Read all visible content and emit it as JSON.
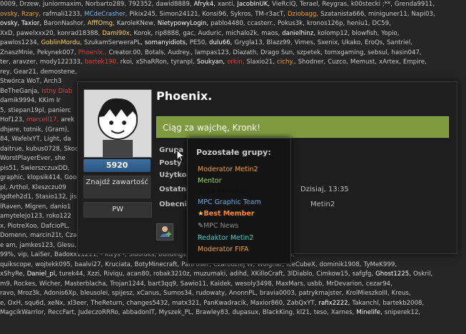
{
  "background_rows": [
    [
      {
        "t": "0009, Drzew,"
      },
      {
        "t": "juniormaxim,"
      },
      {
        "t": "Norbarto289,"
      },
      {
        "t": "792352,"
      },
      {
        "t": "dawid8889,"
      },
      {
        "t": "Afryk4,",
        "c": "c-white"
      },
      {
        "t": "xanti,"
      },
      {
        "t": "JacobInUK,",
        "c": "c-white"
      },
      {
        "t": "VieRciQ,"
      },
      {
        "t": "Terael,"
      },
      {
        "t": "Reygras,"
      },
      {
        "t": "k00stecki ;**,"
      },
      {
        "t": "Grenda9911,"
      }
    ],
    [
      {
        "t": "ovsky, Rzary,",
        "c": "c-orange"
      },
      {
        "t": "rafmali1233,"
      },
      {
        "t": "MCdeCrasher,",
        "c": "c-blue"
      },
      {
        "t": "Pikix245,"
      },
      {
        "t": "Simon24121,"
      },
      {
        "t": "Konsi96,"
      },
      {
        "t": "Sykros,"
      },
      {
        "t": "TM-r3acT,"
      },
      {
        "t": "Dziobagg,",
        "c": "c-orange"
      },
      {
        "t": "Szatanista666,"
      },
      {
        "t": "miniguner11,"
      },
      {
        "t": "Napi03,"
      }
    ],
    [
      {
        "t": "ovsky, Taxior,",
        "c": "c-white"
      },
      {
        "t": "BaronNashor,"
      },
      {
        "t": "AfffOmg,",
        "c": "c-yellow"
      },
      {
        "t": "KaroleKNew,"
      },
      {
        "t": "NietypowyLogin,",
        "c": "c-white"
      },
      {
        "t": "pablo4480,"
      },
      {
        "t": "ccasterr.,"
      },
      {
        "t": "Pokus3k,"
      },
      {
        "t": "kronos126p,"
      },
      {
        "t": "heniu1,"
      },
      {
        "t": "DC59,"
      }
    ],
    [
      {
        "t": "XxD, pawelxxx20,"
      },
      {
        "t": "konrad18388,"
      },
      {
        "t": "Dami90x,",
        "c": "c-yellow"
      },
      {
        "t": "Korok,"
      },
      {
        "t": "rip8888,"
      },
      {
        "t": "gac,"
      },
      {
        "t": "Auduric,"
      },
      {
        "t": "michalo2k,"
      },
      {
        "t": "maos,"
      },
      {
        "t": "danielhinz,",
        "c": "c-white"
      },
      {
        "t": "kolomp12,"
      },
      {
        "t": "blowfish,"
      },
      {
        "t": "Yopio,"
      }
    ],
    [
      {
        "t": "pawlos1234,"
      },
      {
        "t": "GoblinMordu,",
        "c": "c-yellow"
      },
      {
        "t": "SzukamSerweraPL,"
      },
      {
        "t": "somanyidiots,",
        "c": "c-white"
      },
      {
        "t": "PE50,"
      },
      {
        "t": "dulu66,",
        "c": "c-white"
      },
      {
        "t": "Gryglа13,"
      },
      {
        "t": "Blazz99,"
      },
      {
        "t": "Vimes,"
      },
      {
        "t": "Sxenix,"
      },
      {
        "t": "Ukako,"
      },
      {
        "t": "EroQs,"
      },
      {
        "t": "Santriel,"
      }
    ],
    [
      {
        "t": "ZnaszMnie,"
      },
      {
        "t": "Pekynek007,"
      },
      {
        "t": "Phoenix.,",
        "c": "c-red"
      },
      {
        "t": "Creator.00,"
      },
      {
        "t": "Botals,"
      },
      {
        "t": "Audrey.,"
      },
      {
        "t": "lampas123,"
      },
      {
        "t": "Diazath,"
      },
      {
        "t": "Drago Sun,"
      },
      {
        "t": "szpetek,"
      },
      {
        "t": "tomxgaming,"
      },
      {
        "t": "sebsul,"
      },
      {
        "t": "hasin047,"
      }
    ],
    [
      {
        "t": "ter, aravzer,"
      },
      {
        "t": "mody122333,"
      },
      {
        "t": "bartek190,",
        "c": "c-red"
      },
      {
        "t": "rkoi,"
      },
      {
        "t": "xShaRRon,"
      },
      {
        "t": "tyranpl,"
      },
      {
        "t": "Soukyan,",
        "c": "c-white"
      },
      {
        "t": "orkin,",
        "c": "c-red"
      },
      {
        "t": "Slaxio21,"
      },
      {
        "t": "cichy.,",
        "c": "c-orange"
      },
      {
        "t": "Shodner,"
      },
      {
        "t": "Cuzco,"
      },
      {
        "t": "Memust,"
      },
      {
        "t": "xArtex,"
      },
      {
        "t": "Empire,"
      }
    ],
    [
      {
        "t": "rey, Gear21,"
      },
      {
        "t": "demostene,"
      }
    ],
    [
      {
        "t": "Stwórca WoT,"
      },
      {
        "t": "Arch3"
      }
    ],
    [
      {
        "t": "BeTheGanja,"
      },
      {
        "t": "Istny Diab",
        "c": "c-red"
      }
    ],
    [
      {
        "t": "damik9994,"
      },
      {
        "t": "KKim Ir"
      }
    ],
    [
      {
        "t": "5,"
      },
      {
        "t": "stiepan19pl,"
      },
      {
        "t": "panierc"
      }
    ],
    [
      {
        "t": "Hof123,"
      },
      {
        "t": "marcell17,",
        "c": "c-red"
      },
      {
        "t": "arek"
      }
    ],
    [
      {
        "t": "dhjere,"
      },
      {
        "t": "totnik,"
      },
      {
        "t": "(Gram),"
      }
    ],
    [
      {
        "t": "84, WafelxYT,"
      },
      {
        "t": "Light,"
      },
      {
        "t": "da"
      }
    ],
    [
      {
        "t": "daitrue,"
      },
      {
        "t": "kubus0728,"
      },
      {
        "t": "Skoc"
      }
    ],
    [
      {
        "t": "WorstPlayerEver,"
      },
      {
        "t": "she"
      }
    ],
    [
      {
        "t": "pis51,"
      },
      {
        "t": "SwierszczuxDD,"
      }
    ],
    [
      {
        "t": "graphic,"
      },
      {
        "t": "klopsik414,"
      },
      {
        "t": "Good"
      }
    ],
    [
      {
        "t": "pl, Arthol,"
      },
      {
        "t": "Kleszczu09"
      }
    ],
    [
      {
        "t": "Igdteh2d1,"
      },
      {
        "t": "Stasio132,"
      },
      {
        "t": "jiss"
      }
    ],
    [
      {
        "t": "lRaven,"
      },
      {
        "t": "Migren,"
      },
      {
        "t": "danio1"
      }
    ],
    [
      {
        "t": "amytelejo123,"
      },
      {
        "t": "roko122"
      }
    ],
    [
      {
        "t": "x, PiotreXoo,"
      },
      {
        "t": "DafcioPL,"
      }
    ],
    [
      {
        "t": "Domenn,"
      },
      {
        "t": "marcin21t,"
      },
      {
        "t": "Cza"
      }
    ],
    [
      {
        "t": "e am,"
      },
      {
        "t": "jamkes123,"
      },
      {
        "t": "Glesu,"
      },
      {
        "t": "TheKuduro,"
      },
      {
        "t": "Tomodachi,"
      },
      {
        "t": "raxooo"
      },
      {
        "t": "HaKERxD,"
      },
      {
        "t": "Groxik077,"
      },
      {
        "t": "AnayerTeam,"
      },
      {
        "t": "AdamekXx,"
      }
    ],
    [
      {
        "t": "99%,"
      },
      {
        "t": "vip,"
      },
      {
        "t": "LaiSer,"
      },
      {
        "t": "Badoxx11211,"
      },
      {
        "t": "- Kizys -,"
      },
      {
        "t": "Sidoluks,"
      },
      {
        "t": "buildings,"
      },
      {
        "t": "cysiu9000,"
      },
      {
        "t": "Freed65,"
      },
      {
        "t": "elvermorcka,"
      }
    ],
    [
      {
        "t": "quikscope,"
      },
      {
        "t": "wojtekk095,"
      },
      {
        "t": "baalvi27,"
      },
      {
        "t": "Kruciata,"
      },
      {
        "t": "BotyMinecraft,"
      },
      {
        "t": "PanPoser,"
      },
      {
        "t": "Czarodziej W,"
      },
      {
        "t": "Wolghar,"
      },
      {
        "t": "IceCubeX,"
      },
      {
        "t": "dominik1908,"
      },
      {
        "t": "TyMeK999,"
      }
    ],
    [
      {
        "t": "xShyRe,"
      },
      {
        "t": "Daniel_pl,",
        "c": "c-white"
      },
      {
        "t": "turek44,"
      },
      {
        "t": "Xzzi,"
      },
      {
        "t": "Riviqu,"
      },
      {
        "t": "acan80,"
      },
      {
        "t": "robak3210z,"
      },
      {
        "t": "muzumaki,"
      },
      {
        "t": "adihd,"
      },
      {
        "t": "XKilloCraft,"
      },
      {
        "t": "3lDiablo,"
      },
      {
        "t": "Cimkow15,"
      },
      {
        "t": "safgfg,"
      },
      {
        "t": "Ghost1225,",
        "c": "c-white"
      },
      {
        "t": "Oskril,"
      }
    ],
    [
      {
        "t": "m9, Rockes,"
      },
      {
        "t": "Wicher,"
      },
      {
        "t": "Masterblacha,"
      },
      {
        "t": "Trojan1244,"
      },
      {
        "t": "bart3qq9,"
      },
      {
        "t": "Sawio11,"
      },
      {
        "t": "Kaidek,"
      },
      {
        "t": "wesoly3498,"
      },
      {
        "t": "MaxMars,"
      },
      {
        "t": "usbb,"
      },
      {
        "t": "MrDevarion,"
      },
      {
        "t": "cezar94,"
      }
    ],
    [
      {
        "t": "ravo, Mroz3k,"
      },
      {
        "t": "Adonis6Xp,"
      },
      {
        "t": "bleusolei,"
      },
      {
        "t": "spijesz,"
      },
      {
        "t": "xCanus,"
      },
      {
        "t": "Sumos34,"
      },
      {
        "t": "rudowaty,"
      },
      {
        "t": "AnonnPL,"
      },
      {
        "t": "bravia0003,"
      },
      {
        "t": "patrykmajster,"
      },
      {
        "t": "KrolMieszkoIII,"
      },
      {
        "t": "Kreus,"
      }
    ],
    [
      {
        "t": "e, OxH,"
      },
      {
        "t": "squ6d,"
      },
      {
        "t": "xeNx,"
      },
      {
        "t": "xl3eer,"
      },
      {
        "t": "TheReturn,"
      },
      {
        "t": "changes5432,"
      },
      {
        "t": "matx321,"
      },
      {
        "t": "PanKwadracik,"
      },
      {
        "t": "Maxior860,"
      },
      {
        "t": "ZabQxYT,"
      },
      {
        "t": "rafix2222,",
        "c": "c-white"
      },
      {
        "t": "Takanchi,"
      },
      {
        "t": "bartekb2008,"
      }
    ],
    [
      {
        "t": "MagcikWarrior,"
      },
      {
        "t": "ReccFart,"
      },
      {
        "t": "JudeczoRRRo,"
      },
      {
        "t": "abbadonIT,"
      },
      {
        "t": "Myszek_PL,"
      },
      {
        "t": "Brawley83,"
      },
      {
        "t": "dupasux,"
      },
      {
        "t": "BlackKing,"
      },
      {
        "t": "kl21,"
      },
      {
        "t": "teso,"
      },
      {
        "t": "Xarnes,"
      },
      {
        "t": "Minelife,",
        "c": "c-white"
      },
      {
        "t": "sniperek12,"
      }
    ]
  ],
  "profile": {
    "username": "Phoenix.",
    "post_count": "5920",
    "find_content_label": "Znajdź zawartość",
    "pm_label": "PW",
    "status": "Ciąg za wajchę, Kronk!",
    "labels": {
      "group": "Grupa",
      "posts": "Posty",
      "user": "Użytkow",
      "last": "Ostatnio",
      "current": "Obecnie"
    },
    "last_visit_value": "Dzisiaj, 13:35",
    "current_value": "Metin2",
    "add_friend_icon": "add-friend-icon"
  },
  "groups_popup": {
    "title": "Pozostałe grupy:",
    "groups": [
      {
        "label": "Moderator Metin2",
        "color": "#f0a030"
      },
      {
        "label": "Mentor",
        "color": "#9ed45f"
      },
      {
        "label": "Black Member",
        "color": "#111111"
      },
      {
        "label": "MPC Graphic Team",
        "color": "#6aa6d8"
      },
      {
        "label": "Best Member",
        "color": "#ff8a2a"
      },
      {
        "label": "MPC News",
        "color": "#8a8a8a"
      },
      {
        "label": "Redaktor Metin2",
        "color": "#3fd1c4"
      },
      {
        "label": "Moderator FIFA",
        "color": "#f0a030"
      }
    ]
  },
  "colors": {
    "status_bar": "#7e9a3f",
    "post_badge": "#3d6fa0",
    "page_bg": "#262626"
  }
}
